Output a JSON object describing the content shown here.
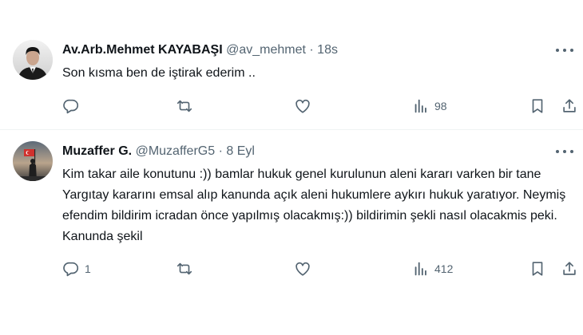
{
  "tweets": [
    {
      "name": "Av.Arb.Mehmet KAYABAŞI",
      "handle": "@av_mehmet",
      "separator": "·",
      "time": "18s",
      "text": "Son kısma ben de iştirak ederim ..",
      "replies": "",
      "retweets": "",
      "likes": "",
      "views": "98"
    },
    {
      "name": "Muzaffer G.",
      "handle": "@MuzafferG5",
      "separator": "·",
      "time": "8 Eyl",
      "text": "Kim takar aile konutunu :)) bamlar hukuk genel kurulunun aleni kararı varken bir tane Yargıtay kararını emsal alıp kanunda açık aleni hukumlere aykırı hukuk yaratıyor. Neymiş efendim bildirim icradan önce yapılmış olacakmış:)) bildirimin şekli nasıl olacakmis peki. Kanunda şekil",
      "replies": "1",
      "retweets": "",
      "likes": "",
      "views": "412"
    }
  ],
  "icons": {
    "reply": "reply-icon",
    "retweet": "retweet-icon",
    "like": "like-icon",
    "views": "views-icon",
    "bookmark": "bookmark-icon",
    "share": "share-icon",
    "more": "more-icon"
  },
  "colors": {
    "text": "#0f1419",
    "secondary": "#536471",
    "divider": "#eff3f4"
  }
}
